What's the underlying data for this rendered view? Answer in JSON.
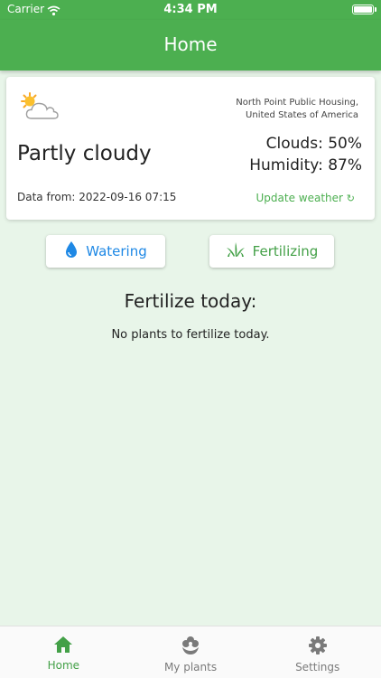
{
  "status_bar": {
    "carrier": "Carrier",
    "time": "4:34 PM"
  },
  "app_bar": {
    "title": "Home"
  },
  "weather": {
    "icon": "partly-cloudy-icon",
    "location_line1": "North Point Public Housing,",
    "location_line2": "United States of America",
    "condition": "Partly cloudy",
    "clouds": "Clouds: 50%",
    "humidity": "Humidity: 87%",
    "data_from": "Data from: 2022-09-16 07:15",
    "update_label": "Update weather",
    "update_icon": "↻"
  },
  "tabs": {
    "watering": {
      "label": "Watering",
      "icon": "water-drop-icon",
      "color": "#1e88e5"
    },
    "fertilizing": {
      "label": "Fertilizing",
      "icon": "grass-icon",
      "color": "#43a047"
    }
  },
  "main": {
    "section_title": "Fertilize today:",
    "empty_message": "No plants to fertilize today."
  },
  "bottom_nav": {
    "items": [
      {
        "label": "Home",
        "icon": "home-icon",
        "active": true
      },
      {
        "label": "My plants",
        "icon": "plant-icon",
        "active": false
      },
      {
        "label": "Settings",
        "icon": "gear-icon",
        "active": false
      }
    ]
  },
  "colors": {
    "primary": "#4caf50",
    "background": "#e8f5e9",
    "water": "#1e88e5"
  }
}
